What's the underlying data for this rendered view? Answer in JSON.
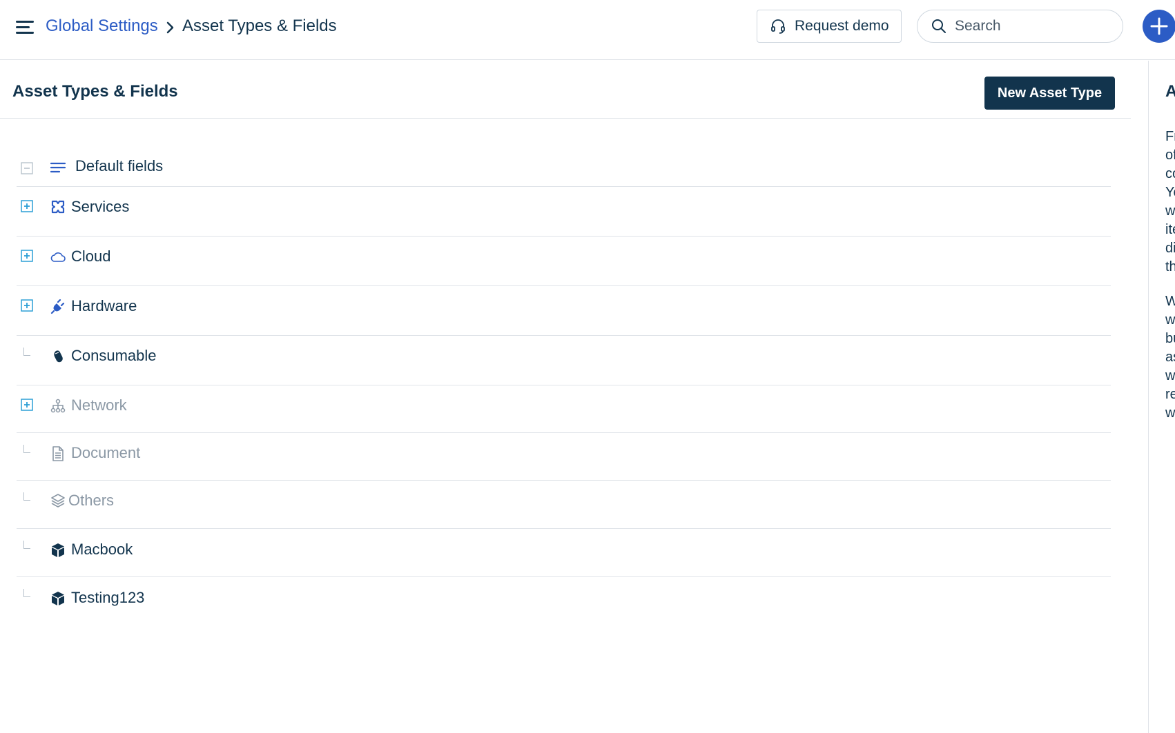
{
  "header": {
    "breadcrumb_link": "Global Settings",
    "breadcrumb_current": "Asset Types & Fields",
    "request_demo_label": "Request demo",
    "search_placeholder": "Search"
  },
  "main": {
    "title": "Asset Types & Fields",
    "new_button_label": "New Asset Type"
  },
  "tree": {
    "items": [
      {
        "label": "Default fields",
        "icon": "lines-icon",
        "toggle": "minus",
        "muted": false
      },
      {
        "label": "Services",
        "icon": "services-icon",
        "toggle": "plus",
        "muted": false
      },
      {
        "label": "Cloud",
        "icon": "cloud-icon",
        "toggle": "plus",
        "muted": false
      },
      {
        "label": "Hardware",
        "icon": "plug-icon",
        "toggle": "plus",
        "muted": false
      },
      {
        "label": "Consumable",
        "icon": "mouse-icon",
        "toggle": "leaf",
        "muted": false
      },
      {
        "label": "Network",
        "icon": "network-icon",
        "toggle": "plus",
        "muted": true
      },
      {
        "label": "Document",
        "icon": "document-icon",
        "toggle": "leaf",
        "muted": true
      },
      {
        "label": "Others",
        "icon": "layers-icon",
        "toggle": "leaf",
        "muted": true
      },
      {
        "label": "Macbook",
        "icon": "box-icon",
        "toggle": "leaf",
        "muted": false
      },
      {
        "label": "Testing123",
        "icon": "box-icon",
        "toggle": "leaf",
        "muted": false
      }
    ]
  },
  "right_panel": {
    "heading": "A",
    "paragraph1": [
      "Fr",
      "of",
      "co",
      "Yo",
      "w",
      "ite",
      "di",
      "th"
    ],
    "paragraph2": [
      "W",
      "w",
      "bu",
      "as",
      "w",
      "re",
      "w"
    ]
  },
  "colors": {
    "primary_dark": "#12344d",
    "link_blue": "#2c5cc5",
    "toggle_blue": "#2c9fd6",
    "border": "#dfe3e8",
    "muted_text": "#8b98a5"
  }
}
